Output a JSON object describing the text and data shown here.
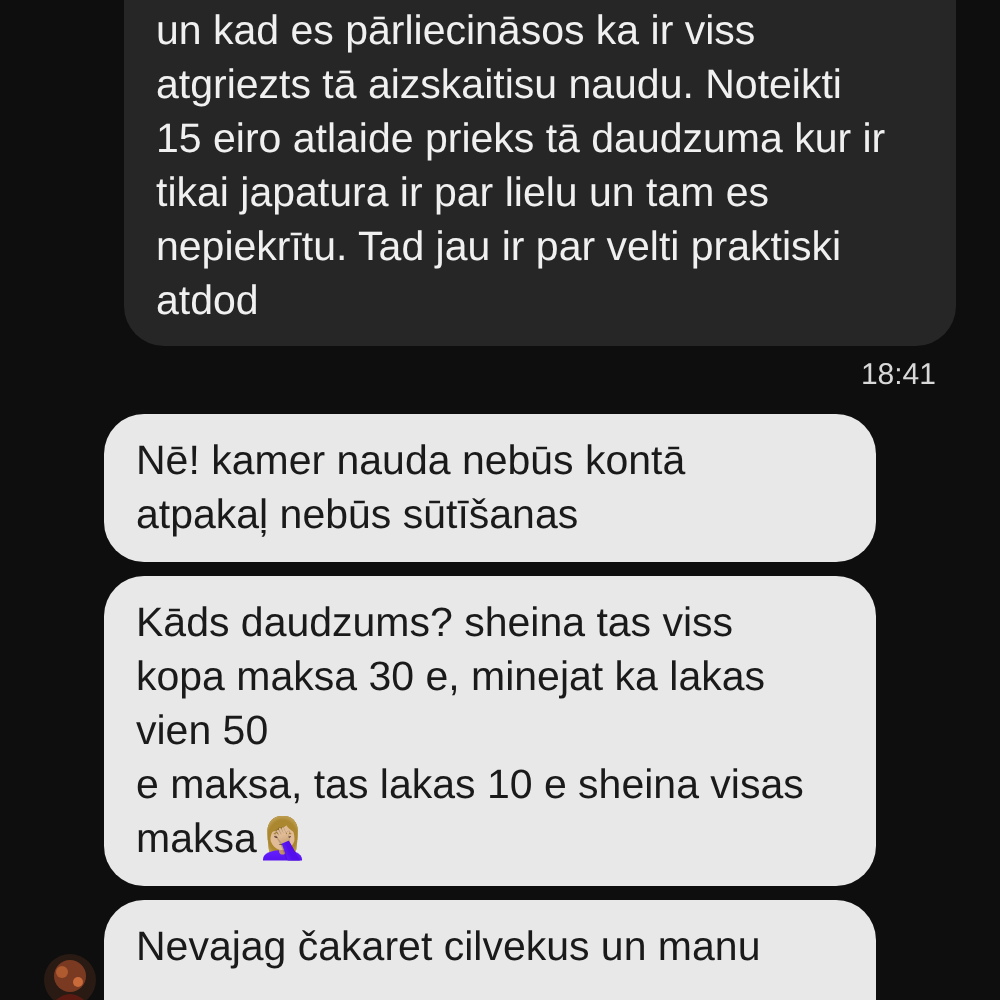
{
  "messages": [
    {
      "kind": "outgoing",
      "text": "un kad es pārliecināsos ka ir viss\natgriezts tā aizskaitisu naudu. Noteikti\n15 eiro atlaide prieks tā daudzuma kur ir\ntikai japatura ir par lielu un tam es\nnepiekrītu. Tad jau ir par velti praktiski\natdod",
      "time": "18:41"
    },
    {
      "kind": "incoming",
      "text": "Nē! kamer nauda nebūs kontā\natpakaļ nebūs sūtīšanas",
      "avatar": false
    },
    {
      "kind": "incoming",
      "text": "Kāds daudzums? sheina tas viss\nkopa maksa 30 e, minejat ka lakas\nvien 50\ne maksa, tas lakas 10 e sheina visas\nmaksa🤦🏼‍♀️",
      "avatar": false
    },
    {
      "kind": "incoming",
      "text": "Nevajag čakaret cilvekus un manu",
      "avatar": true
    }
  ]
}
